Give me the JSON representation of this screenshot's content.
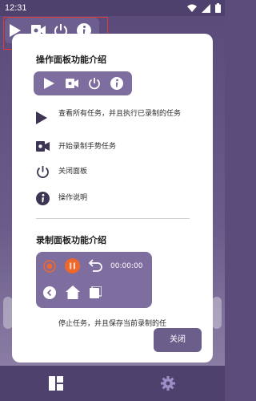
{
  "status_bar": {
    "time": "12:31",
    "icons": [
      "wifi-icon",
      "signal-icon",
      "battery-icon"
    ]
  },
  "floating_panel": {
    "icons": [
      "play-icon",
      "video-camera-icon",
      "power-icon",
      "info-icon"
    ],
    "highlight_color": "#e53935"
  },
  "dialog": {
    "section1_title": "操作面板功能介绍",
    "features": [
      {
        "icon": "play-icon",
        "text": "查看所有任务，并且执行已录制的任务"
      },
      {
        "icon": "video-camera-icon",
        "text": "开始录制手势任务"
      },
      {
        "icon": "power-icon",
        "text": "关闭面板"
      },
      {
        "icon": "info-icon",
        "text": "操作说明"
      }
    ],
    "section2_title": "录制面板功能介绍",
    "record_panel": {
      "timer": "00:00:00",
      "icons": [
        "record-icon",
        "pause-icon",
        "undo-icon",
        "back-icon",
        "home-icon",
        "recent-apps-icon"
      ]
    },
    "partial_text": "停止任务，并且保存当前录制的任",
    "close_label": "关闭"
  },
  "bottom_nav": {
    "icons": [
      "dashboard-icon",
      "settings-gear-icon"
    ]
  },
  "colors": {
    "accent": "#7e6d9f",
    "nav_bg": "#4f416d",
    "record_orange": "#f0672c",
    "settings_icon": "#9f8fc8"
  }
}
